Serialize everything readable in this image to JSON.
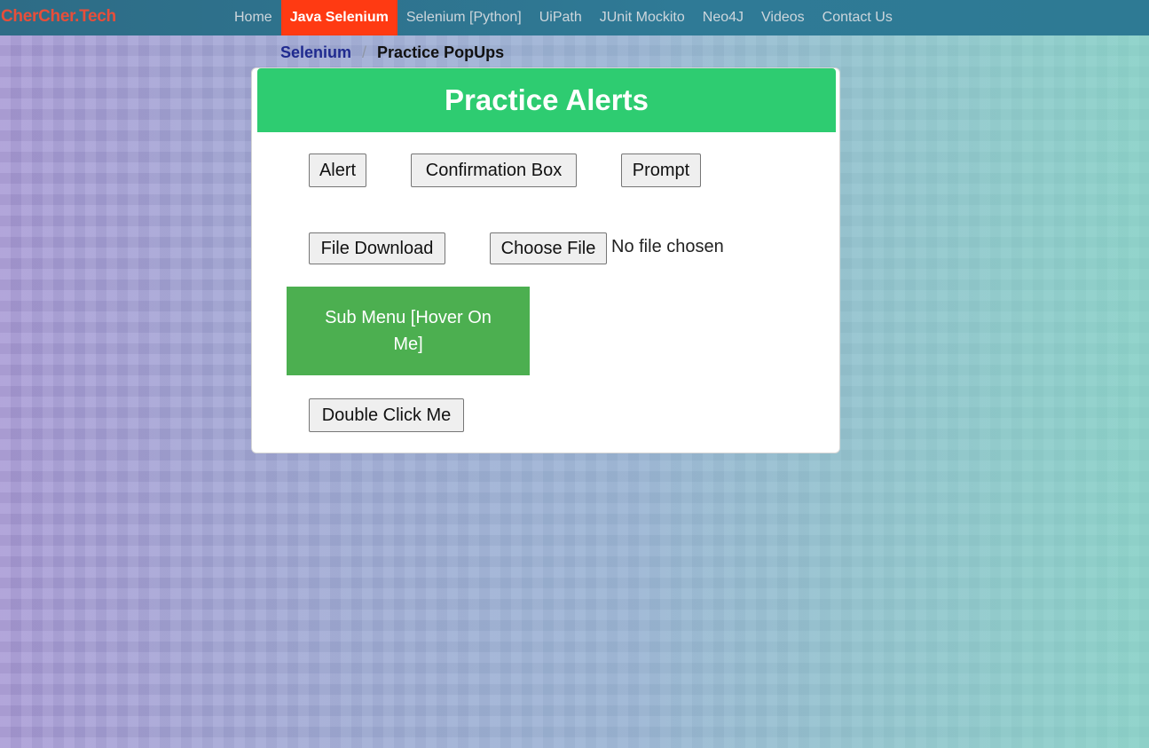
{
  "navbar": {
    "brand": "CherCher.Tech",
    "items": [
      {
        "label": "Home",
        "active": false
      },
      {
        "label": "Java Selenium",
        "active": true
      },
      {
        "label": "Selenium [Python]",
        "active": false
      },
      {
        "label": "UiPath",
        "active": false
      },
      {
        "label": "JUnit Mockito",
        "active": false
      },
      {
        "label": "Neo4J",
        "active": false
      },
      {
        "label": "Videos",
        "active": false
      },
      {
        "label": "Contact Us",
        "active": false
      }
    ]
  },
  "breadcrumb": {
    "parent": "Selenium",
    "separator": "/",
    "current": "Practice PopUps"
  },
  "card": {
    "title": "Practice Alerts",
    "buttons": {
      "alert": "Alert",
      "confirmation": "Confirmation Box",
      "prompt": "Prompt",
      "file_download": "File Download",
      "choose_file": "Choose File",
      "double_click": "Double Click Me"
    },
    "file_status": "No file chosen",
    "submenu_label": "Sub Menu [Hover On Me]"
  },
  "colors": {
    "nav_active": "#ff3a12",
    "header_green": "#2ecc71",
    "submenu_green": "#4caf50",
    "brand_red": "#e84e3a"
  }
}
